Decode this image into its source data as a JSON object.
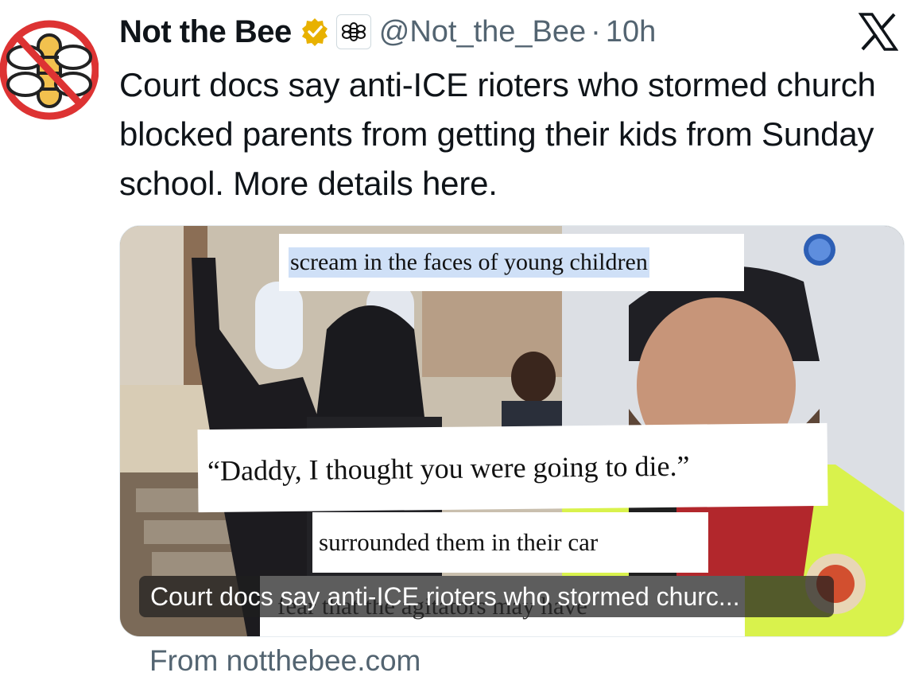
{
  "tweet": {
    "display_name": "Not the Bee",
    "handle": "@Not_the_Bee",
    "separator": "·",
    "time": "10h",
    "verified_icon": "gold-verified-badge-icon",
    "affiliation_icon": "bee-logo-icon",
    "platform_icon": "x-logo-icon",
    "text": "Court docs say anti-ICE rioters who stormed church blocked parents from getting their kids from Sunday school. More details here."
  },
  "card": {
    "quotes": [
      "scream in the faces of young children",
      "“Daddy, I thought you were going to die.”",
      "surrounded them in their car",
      "fear that the agitators may have"
    ],
    "caption": "Court docs say anti-ICE rioters who stormed churc...",
    "source": "From notthebee.com"
  },
  "colors": {
    "accent_gold": "#e8b100",
    "caption_bg": "#1e1e1e",
    "muted_text": "#536471",
    "highlight": "#cfe0f7"
  }
}
